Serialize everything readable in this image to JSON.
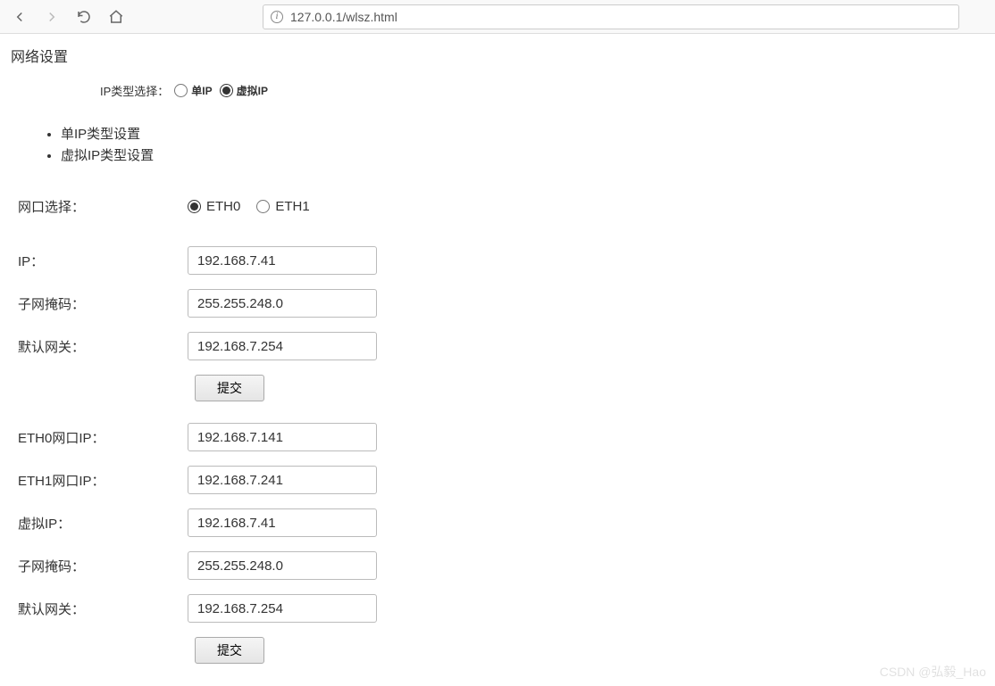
{
  "browser": {
    "url": "127.0.0.1/wlsz.html"
  },
  "page": {
    "title": "网络设置"
  },
  "ip_type": {
    "label": "IP类型选择：",
    "option_single": "单IP",
    "option_virtual": "虚拟IP",
    "selected": "virtual"
  },
  "bullets": {
    "item1": "单IP类型设置",
    "item2": "虚拟IP类型设置"
  },
  "eth_select": {
    "label": "网口选择：",
    "option0": "ETH0",
    "option1": "ETH1",
    "selected": "eth0"
  },
  "form1": {
    "ip_label": "IP：",
    "ip_value": "192.168.7.41",
    "mask_label": "子网掩码：",
    "mask_value": "255.255.248.0",
    "gw_label": "默认网关：",
    "gw_value": "192.168.7.254",
    "submit": "提交"
  },
  "form2": {
    "eth0ip_label": "ETH0网口IP：",
    "eth0ip_value": "192.168.7.141",
    "eth1ip_label": "ETH1网口IP：",
    "eth1ip_value": "192.168.7.241",
    "vip_label": "虚拟IP：",
    "vip_value": "192.168.7.41",
    "mask_label": "子网掩码：",
    "mask_value": "255.255.248.0",
    "gw_label": "默认网关：",
    "gw_value": "192.168.7.254",
    "submit": "提交"
  },
  "watermark": "CSDN @弘毅_Hao"
}
